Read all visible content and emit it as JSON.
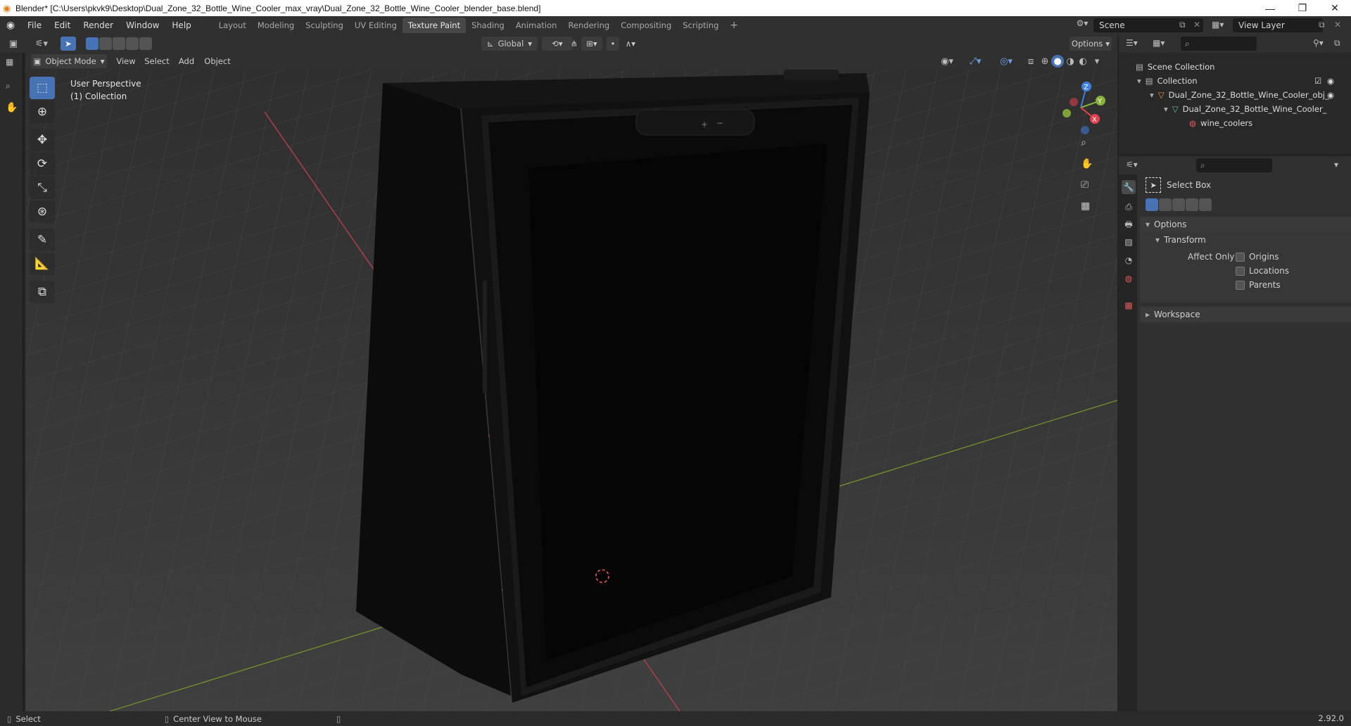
{
  "titlebar": {
    "title": "Blender* [C:\\Users\\pkvk9\\Desktop\\Dual_Zone_32_Bottle_Wine_Cooler_max_vray\\Dual_Zone_32_Bottle_Wine_Cooler_blender_base.blend]",
    "minimize": "—",
    "maximize": "❐",
    "close": "✕"
  },
  "menu": [
    "File",
    "Edit",
    "Render",
    "Window",
    "Help"
  ],
  "workspaces": [
    "Layout",
    "Modeling",
    "Sculpting",
    "UV Editing",
    "Texture Paint",
    "Shading",
    "Animation",
    "Rendering",
    "Compositing",
    "Scripting"
  ],
  "active_workspace": "Texture Paint",
  "add_workspace": "+",
  "scene": {
    "label": "Scene",
    "view_layer": "View Layer"
  },
  "viewport_header": {
    "mode": "Object Mode",
    "view": "View",
    "select": "Select",
    "add": "Add",
    "object": "Object",
    "orientation": "Global",
    "options": "Options"
  },
  "overlay": {
    "perspective": "User Perspective",
    "collection": "(1) Collection"
  },
  "gizmo": {
    "x": "X",
    "y": "Y",
    "z": "Z"
  },
  "outliner": {
    "scene_collection": "Scene Collection",
    "collection": "Collection",
    "object": "Dual_Zone_32_Bottle_Wine_Cooler_obj_",
    "mesh": "Dual_Zone_32_Bottle_Wine_Cooler_",
    "material": "wine_coolers"
  },
  "properties": {
    "tool_name": "Select Box",
    "options": "Options",
    "transform": "Transform",
    "affect_only": "Affect Only",
    "origins": "Origins",
    "locations": "Locations",
    "parents": "Parents",
    "workspace": "Workspace"
  },
  "status": {
    "select": "Select",
    "center_view": "Center View to Mouse",
    "version": "2.92.0"
  },
  "colors": {
    "accent": "#4772b3",
    "x_axis": "#e4414e",
    "y_axis": "#87b13a",
    "z_axis": "#3f7ee0"
  }
}
